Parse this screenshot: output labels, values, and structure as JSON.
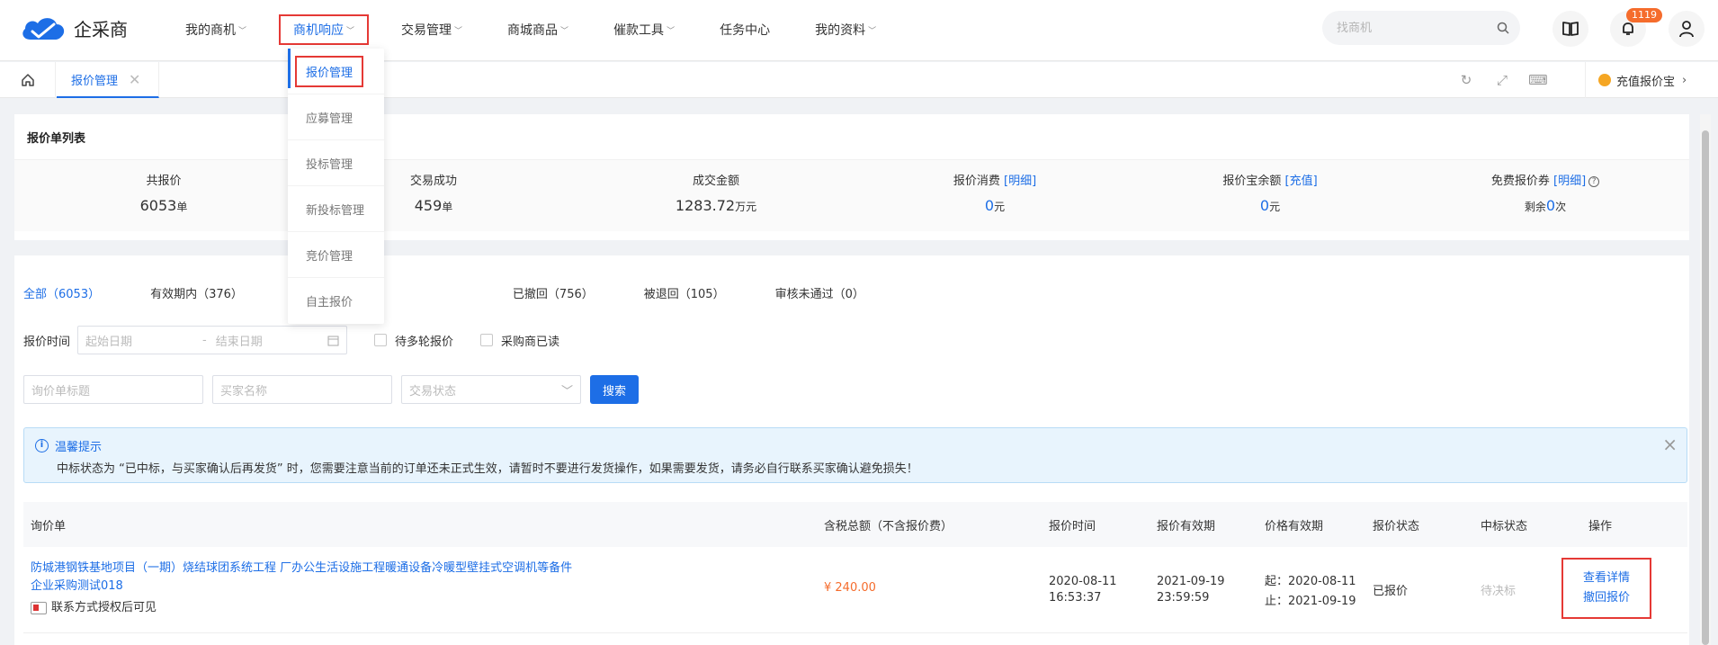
{
  "brand": {
    "name": "企采商",
    "color": "#1d6ee6"
  },
  "nav": {
    "items": [
      {
        "label": "我的商机"
      },
      {
        "label": "商机响应"
      },
      {
        "label": "交易管理"
      },
      {
        "label": "商城商品"
      },
      {
        "label": "催款工具"
      },
      {
        "label": "任务中心"
      },
      {
        "label": "我的资料"
      }
    ],
    "search_placeholder": "找商机",
    "notification_count": "1119"
  },
  "dropdown": {
    "items": [
      {
        "label": "报价管理"
      },
      {
        "label": "应募管理"
      },
      {
        "label": "投标管理"
      },
      {
        "label": "新投标管理"
      },
      {
        "label": "竞价管理"
      },
      {
        "label": "自主报价"
      }
    ]
  },
  "tabs": {
    "active": "报价管理",
    "recharge": "充值报价宝"
  },
  "stats": {
    "card_title": "报价单列表",
    "items": [
      {
        "label": "共报价",
        "value": "6053",
        "unit": "单"
      },
      {
        "label": "交易成功",
        "value": "459",
        "unit": "单"
      },
      {
        "label": "成交金额",
        "value": "1283.72",
        "unit": "万元"
      },
      {
        "label": "报价消费",
        "link": "[明细]",
        "value": "0",
        "unit": "元"
      },
      {
        "label": "报价宝余额",
        "link": "[充值]",
        "value": "0",
        "unit": "元"
      },
      {
        "label": "免费报价券",
        "link": "[明细]",
        "prefix": "剩余",
        "value": "0",
        "unit": "次"
      }
    ]
  },
  "filters": {
    "tabs": [
      "全部（6053）",
      "有效期内（376）",
      "已撤回（756）",
      "被退回（105）",
      "审核未通过（0）"
    ],
    "date_label": "报价时间",
    "start_placeholder": "起始日期",
    "end_placeholder": "结束日期",
    "date_sep": "-",
    "check1": "待多轮报价",
    "check2": "采购商已读",
    "title_placeholder": "询价单标题",
    "buyer_placeholder": "买家名称",
    "status_placeholder": "交易状态",
    "search_btn": "搜索"
  },
  "notice": {
    "title": "温馨提示",
    "message": "中标状态为 “已中标，与买家确认后再发货” 时，您需要注意当前的订单还未正式生效，请暂时不要进行发货操作，如果需要发货，请务必自行联系买家确认避免损失！"
  },
  "table": {
    "headers": [
      "询价单",
      "含税总额（不含报价费）",
      "报价时间",
      "报价有效期",
      "价格有效期",
      "报价状态",
      "中标状态",
      "操作"
    ],
    "rows": [
      {
        "title": "防城港钢铁基地项目（一期）烧结球团系统工程 厂办公生活设施工程暖通设备冷暖型壁挂式空调机等备件",
        "buyer": "企业采购测试018",
        "contact": "联系方式授权后可见",
        "amount": "¥ 240.00",
        "quote_date": "2020-08-11",
        "quote_time": "16:53:37",
        "valid_date": "2021-09-19",
        "valid_time": "23:59:59",
        "price_start": "起：2020-08-11",
        "price_end": "止：2021-09-19",
        "quote_status": "已报价",
        "bid_status": "待决标",
        "op1": "查看详情",
        "op2": "撤回报价"
      }
    ]
  }
}
